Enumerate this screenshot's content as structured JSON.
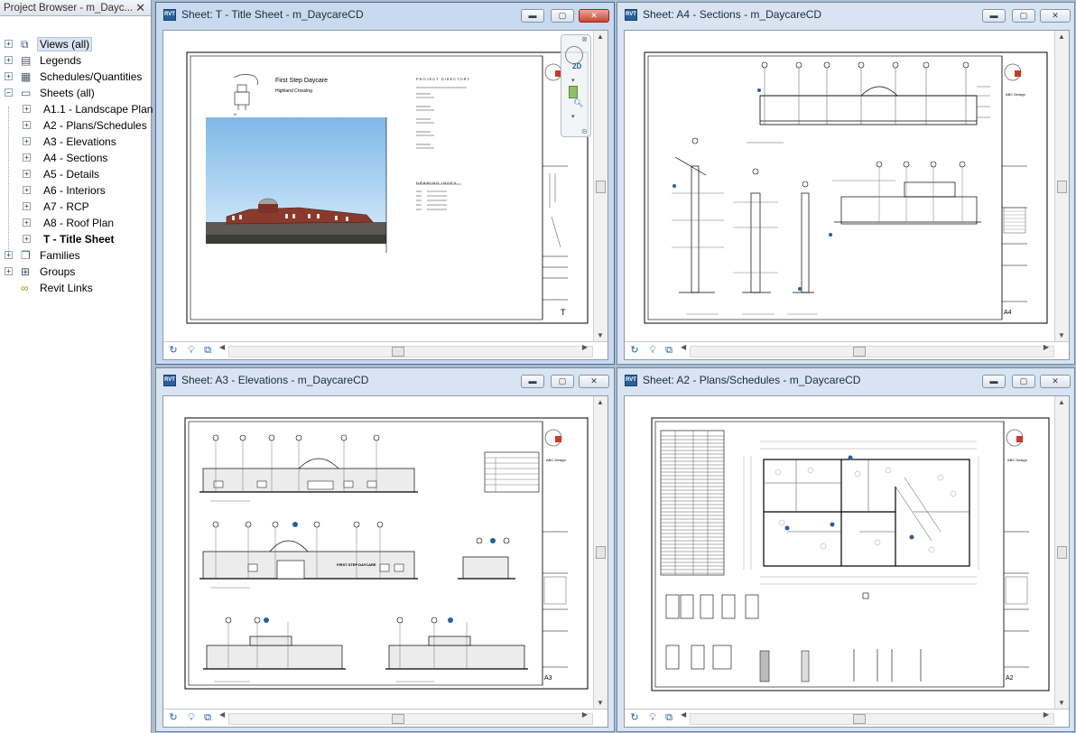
{
  "project_browser": {
    "title": "Project Browser - m_Dayc...",
    "close_glyph": "✕",
    "tree": [
      {
        "label": "Views (all)",
        "level": 0,
        "toggle": "+",
        "icon": "views-icon",
        "selected": true
      },
      {
        "label": "Legends",
        "level": 0,
        "toggle": "+",
        "icon": "legends-icon"
      },
      {
        "label": "Schedules/Quantities",
        "level": 0,
        "toggle": "+",
        "icon": "schedules-icon"
      },
      {
        "label": "Sheets (all)",
        "level": 0,
        "toggle": "−",
        "icon": "sheets-icon"
      },
      {
        "label": "A1.1 - Landscape Plan",
        "level": 1,
        "toggle": "+"
      },
      {
        "label": "A2 - Plans/Schedules",
        "level": 1,
        "toggle": "+"
      },
      {
        "label": "A3 - Elevations",
        "level": 1,
        "toggle": "+"
      },
      {
        "label": "A4 - Sections",
        "level": 1,
        "toggle": "+"
      },
      {
        "label": "A5 - Details",
        "level": 1,
        "toggle": "+"
      },
      {
        "label": "A6 - Interiors",
        "level": 1,
        "toggle": "+"
      },
      {
        "label": "A7 - RCP",
        "level": 1,
        "toggle": "+"
      },
      {
        "label": "A8 - Roof Plan",
        "level": 1,
        "toggle": "+"
      },
      {
        "label": "T - Title Sheet",
        "level": 1,
        "toggle": "+",
        "bold": true
      },
      {
        "label": "Families",
        "level": 0,
        "toggle": "+",
        "icon": "families-icon"
      },
      {
        "label": "Groups",
        "level": 0,
        "toggle": "+",
        "icon": "groups-icon"
      },
      {
        "label": "Revit Links",
        "level": 0,
        "toggle": "",
        "icon": "revit-links-icon"
      }
    ]
  },
  "windows": [
    {
      "title": "Sheet: T - Title Sheet - m_DaycareCD",
      "sheet_number": "T",
      "active": true
    },
    {
      "title": "Sheet: A4 - Sections - m_DaycareCD",
      "sheet_number": "A4"
    },
    {
      "title": "Sheet: A3 - Elevations - m_DaycareCD",
      "sheet_number": "A3"
    },
    {
      "title": "Sheet: A2 - Plans/Schedules - m_DaycareCD",
      "sheet_number": "A2"
    }
  ],
  "window_buttons": {
    "minimize": "▬",
    "maximize": "▢",
    "close": "✕"
  },
  "title_sheet": {
    "project_name": "First Step Daycare",
    "location": "Highland Crossing",
    "project_directory": "PROJECT DIRECTORY",
    "drawing_index": "DRAWING INDEX"
  },
  "sheet_texts": {
    "firm": "ABC Design",
    "banner": "FIRST STEP DAYCARE"
  },
  "navbar": {
    "mode": "2D"
  },
  "colors": {
    "accent": "#2a5f9e",
    "close_red": "#c7452f",
    "sky_top": "#7fb8e8",
    "sky_bottom": "#d7ecfb",
    "brick": "#8a3a2c"
  }
}
